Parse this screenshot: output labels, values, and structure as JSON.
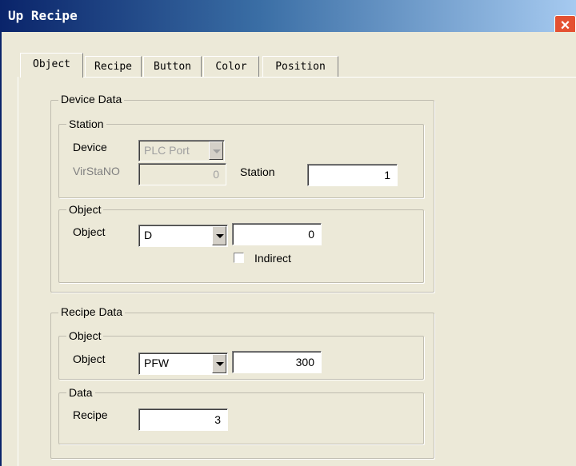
{
  "window": {
    "title": "Up Recipe",
    "close_symbol": "×"
  },
  "tabs": [
    {
      "label": "Object",
      "active": true
    },
    {
      "label": "Recipe"
    },
    {
      "label": "Button"
    },
    {
      "label": "Color"
    },
    {
      "label": "Position"
    }
  ],
  "device_data": {
    "title": "Device Data",
    "station_group": {
      "title": "Station",
      "device_label": "Device",
      "device_value": "PLC Port",
      "virstano_label": "VirStaNO",
      "virstano_value": "0",
      "station_label": "Station",
      "station_value": "1"
    },
    "object_group": {
      "title": "Object",
      "object_label": "Object",
      "object_type": "D",
      "object_address": "0",
      "indirect_label": "Indirect",
      "indirect_checked": false
    }
  },
  "recipe_data": {
    "title": "Recipe Data",
    "object_group": {
      "title": "Object",
      "object_label": "Object",
      "object_type": "PFW",
      "object_address": "300"
    },
    "data_group": {
      "title": "Data",
      "recipe_label": "Recipe",
      "recipe_value": "3"
    }
  },
  "colors": {
    "titlebar_start": "#0a246a",
    "close_button": "#e45131",
    "dialog_bg": "#ece9d8"
  }
}
